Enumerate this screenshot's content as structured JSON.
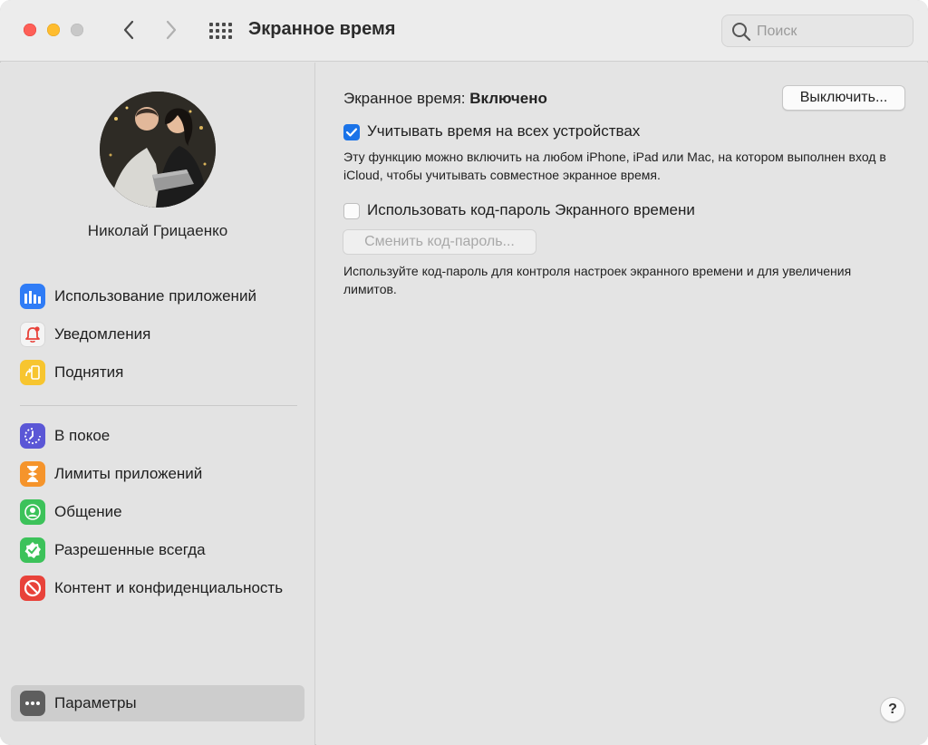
{
  "window": {
    "title": "Экранное время",
    "search_placeholder": "Поиск"
  },
  "sidebar": {
    "user_name": "Николай Грицаенко",
    "groups": [
      {
        "items": [
          {
            "label": "Использование приложений",
            "icon": "bar-chart-icon",
            "color": "#2f7cf6"
          },
          {
            "label": "Уведомления",
            "icon": "bell-icon",
            "color": "#f4f4f4"
          },
          {
            "label": "Поднятия",
            "icon": "phone-pickup-icon",
            "color": "#f7c52f"
          }
        ]
      },
      {
        "items": [
          {
            "label": "В покое",
            "icon": "downtime-icon",
            "color": "#5b57d6"
          },
          {
            "label": "Лимиты приложений",
            "icon": "hourglass-icon",
            "color": "#f5942b"
          },
          {
            "label": "Общение",
            "icon": "person-icon",
            "color": "#3cc25a"
          },
          {
            "label": "Разрешенные всегда",
            "icon": "checkmark-badge-icon",
            "color": "#3cc25a"
          },
          {
            "label": "Контент и конфиденциальность",
            "icon": "no-entry-icon",
            "color": "#e8423a"
          }
        ]
      }
    ],
    "bottom_item": {
      "label": "Параметры",
      "icon": "ellipsis-icon",
      "color": "#5e5e5e",
      "selected": true
    }
  },
  "main": {
    "status_prefix": "Экранное время:",
    "status_value": "Включено",
    "turn_off_button": "Выключить...",
    "share_checkbox": {
      "label": "Учитывать время на всех устройствах",
      "checked": true,
      "description": "Эту функцию можно включить на любом iPhone, iPad или Mac, на котором выполнен вход в iCloud, чтобы учитывать совместное экранное время."
    },
    "passcode_checkbox": {
      "label": "Использовать код-пароль Экранного времени",
      "checked": false,
      "description": "Используйте код-пароль для контроля настроек экранного времени и для увеличения лимитов."
    },
    "change_passcode_button": "Сменить код-пароль...",
    "help_label": "?"
  }
}
